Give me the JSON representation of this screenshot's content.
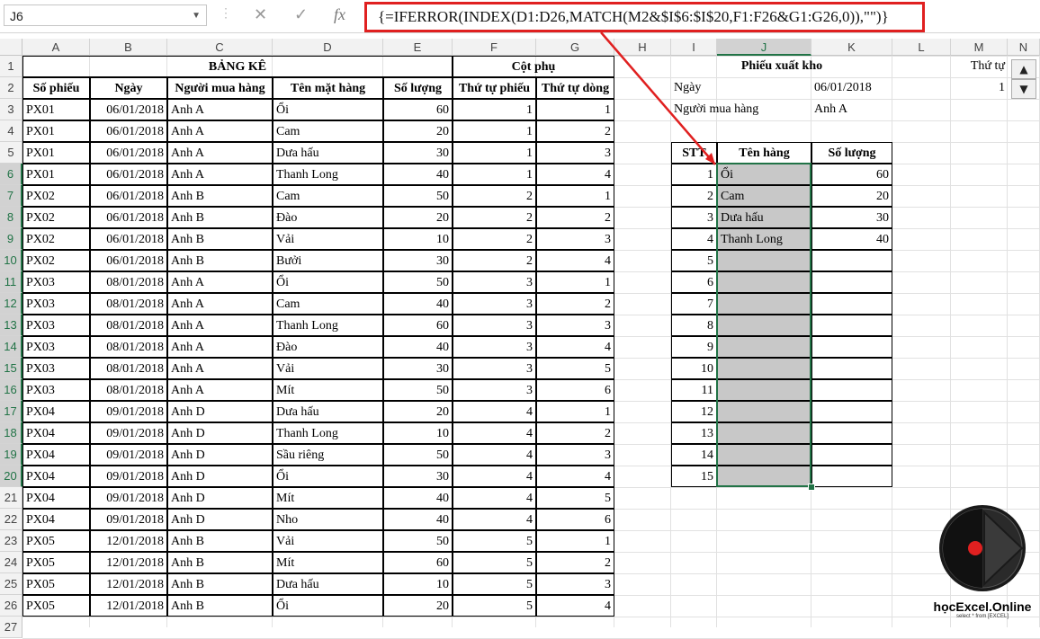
{
  "formula_bar": {
    "name_box": "J6",
    "formula": "{=IFERROR(INDEX(D1:D26,MATCH(M2&$I$6:$I$20,F1:F26&G1:G26,0)),\"\")}"
  },
  "columns": [
    "A",
    "B",
    "C",
    "D",
    "E",
    "F",
    "G",
    "H",
    "I",
    "J",
    "K",
    "L",
    "M",
    "N"
  ],
  "rows": [
    "1",
    "2",
    "3",
    "4",
    "5",
    "6",
    "7",
    "8",
    "9",
    "10",
    "11",
    "12",
    "13",
    "14",
    "15",
    "16",
    "17",
    "18",
    "19",
    "20",
    "21",
    "22",
    "23",
    "24",
    "25",
    "26",
    "27"
  ],
  "ledger": {
    "title": "BẢNG KÊ",
    "aux_title": "Cột phụ",
    "headers": [
      "Số phiếu",
      "Ngày",
      "Người mua hàng",
      "Tên mặt hàng",
      "Số lượng",
      "Thứ tự phiếu",
      "Thứ tự dòng"
    ],
    "rows": [
      [
        "PX01",
        "06/01/2018",
        "Anh A",
        "Ổi",
        "60",
        "1",
        "1"
      ],
      [
        "PX01",
        "06/01/2018",
        "Anh A",
        "Cam",
        "20",
        "1",
        "2"
      ],
      [
        "PX01",
        "06/01/2018",
        "Anh A",
        "Dưa hấu",
        "30",
        "1",
        "3"
      ],
      [
        "PX01",
        "06/01/2018",
        "Anh A",
        "Thanh Long",
        "40",
        "1",
        "4"
      ],
      [
        "PX02",
        "06/01/2018",
        "Anh B",
        "Cam",
        "50",
        "2",
        "1"
      ],
      [
        "PX02",
        "06/01/2018",
        "Anh B",
        "Đào",
        "20",
        "2",
        "2"
      ],
      [
        "PX02",
        "06/01/2018",
        "Anh B",
        "Vải",
        "10",
        "2",
        "3"
      ],
      [
        "PX02",
        "06/01/2018",
        "Anh B",
        "Bưởi",
        "30",
        "2",
        "4"
      ],
      [
        "PX03",
        "08/01/2018",
        "Anh A",
        "Ổi",
        "50",
        "3",
        "1"
      ],
      [
        "PX03",
        "08/01/2018",
        "Anh A",
        "Cam",
        "40",
        "3",
        "2"
      ],
      [
        "PX03",
        "08/01/2018",
        "Anh A",
        "Thanh Long",
        "60",
        "3",
        "3"
      ],
      [
        "PX03",
        "08/01/2018",
        "Anh A",
        "Đào",
        "40",
        "3",
        "4"
      ],
      [
        "PX03",
        "08/01/2018",
        "Anh A",
        "Vải",
        "30",
        "3",
        "5"
      ],
      [
        "PX03",
        "08/01/2018",
        "Anh A",
        "Mít",
        "50",
        "3",
        "6"
      ],
      [
        "PX04",
        "09/01/2018",
        "Anh D",
        "Dưa hấu",
        "20",
        "4",
        "1"
      ],
      [
        "PX04",
        "09/01/2018",
        "Anh D",
        "Thanh Long",
        "10",
        "4",
        "2"
      ],
      [
        "PX04",
        "09/01/2018",
        "Anh D",
        "Sầu riêng",
        "50",
        "4",
        "3"
      ],
      [
        "PX04",
        "09/01/2018",
        "Anh D",
        "Ổi",
        "30",
        "4",
        "4"
      ],
      [
        "PX04",
        "09/01/2018",
        "Anh D",
        "Mít",
        "40",
        "4",
        "5"
      ],
      [
        "PX04",
        "09/01/2018",
        "Anh D",
        "Nho",
        "40",
        "4",
        "6"
      ],
      [
        "PX05",
        "12/01/2018",
        "Anh B",
        "Vải",
        "50",
        "5",
        "1"
      ],
      [
        "PX05",
        "12/01/2018",
        "Anh B",
        "Mít",
        "60",
        "5",
        "2"
      ],
      [
        "PX05",
        "12/01/2018",
        "Anh B",
        "Dưa hấu",
        "10",
        "5",
        "3"
      ],
      [
        "PX05",
        "12/01/2018",
        "Anh B",
        "Ổi",
        "20",
        "5",
        "4"
      ]
    ]
  },
  "slip": {
    "title": "Phiếu xuất kho",
    "date_label": "Ngày",
    "date_value": "06/01/2018",
    "buyer_label": "Người mua hàng",
    "buyer_value": "Anh A",
    "headers": [
      "STT",
      "Tên hàng",
      "Số lượng"
    ],
    "rows": [
      [
        "1",
        "Ổi",
        "60"
      ],
      [
        "2",
        "Cam",
        "20"
      ],
      [
        "3",
        "Dưa hấu",
        "30"
      ],
      [
        "4",
        "Thanh Long",
        "40"
      ],
      [
        "5",
        "",
        ""
      ],
      [
        "6",
        "",
        ""
      ],
      [
        "7",
        "",
        ""
      ],
      [
        "8",
        "",
        ""
      ],
      [
        "9",
        "",
        ""
      ],
      [
        "10",
        "",
        ""
      ],
      [
        "11",
        "",
        ""
      ],
      [
        "12",
        "",
        ""
      ],
      [
        "13",
        "",
        ""
      ],
      [
        "14",
        "",
        ""
      ],
      [
        "15",
        "",
        ""
      ]
    ]
  },
  "counter": {
    "label": "Thứ tự",
    "value": "1",
    "up": "▲",
    "down": "▼"
  },
  "logo": {
    "text": "họcExcel.Online",
    "tagline": "select * from [EXCEL]"
  },
  "colors": {
    "highlight_red": "#e02020",
    "selection_green": "#217346",
    "shade": "#c8c8c8"
  }
}
